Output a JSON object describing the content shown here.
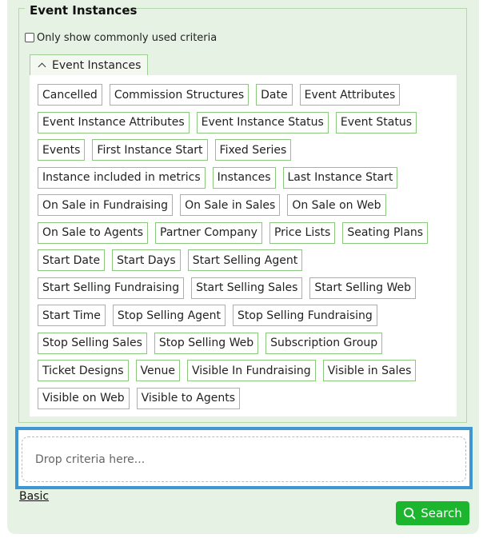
{
  "section": {
    "legend": "Event Instances",
    "common_only_label": "Only show commonly used criteria",
    "common_only_checked": false
  },
  "group": {
    "label": "Event Instances",
    "expanded": true,
    "rows": [
      [
        "Cancelled",
        "Commission Structures",
        "Date",
        "Event Attributes"
      ],
      [
        "Event Instance Attributes",
        "Event Instance Status",
        "Event Status"
      ],
      [
        "Events",
        "First Instance Start",
        "Fixed Series"
      ],
      [
        "Instance included in metrics",
        "Instances",
        "Last Instance Start"
      ],
      [
        "On Sale in Fundraising",
        "On Sale in Sales",
        "On Sale on Web"
      ],
      [
        "On Sale to Agents",
        "Partner Company",
        "Price Lists",
        "Seating Plans"
      ],
      [
        "Start Date",
        "Start Days",
        "Start Selling Agent"
      ],
      [
        "Start Selling Fundraising",
        "Start Selling Sales",
        "Start Selling Web"
      ],
      [
        "Start Time",
        "Stop Selling Agent",
        "Stop Selling Fundraising"
      ],
      [
        "Stop Selling Sales",
        "Stop Selling Web",
        "Subscription Group"
      ],
      [
        "Ticket Designs",
        "Venue",
        "Visible In Fundraising",
        "Visible in Sales"
      ],
      [
        "Visible on Web",
        "Visible to Agents"
      ]
    ]
  },
  "dropzone": {
    "placeholder": "Drop criteria here..."
  },
  "footer": {
    "basic_link": "Basic",
    "search_label": "Search"
  },
  "colors": {
    "panel_bg": "#e6f2e3",
    "chip_border": "#8bc77c",
    "dropzone_highlight": "#3e96d2",
    "search_button": "#1bb52e"
  }
}
